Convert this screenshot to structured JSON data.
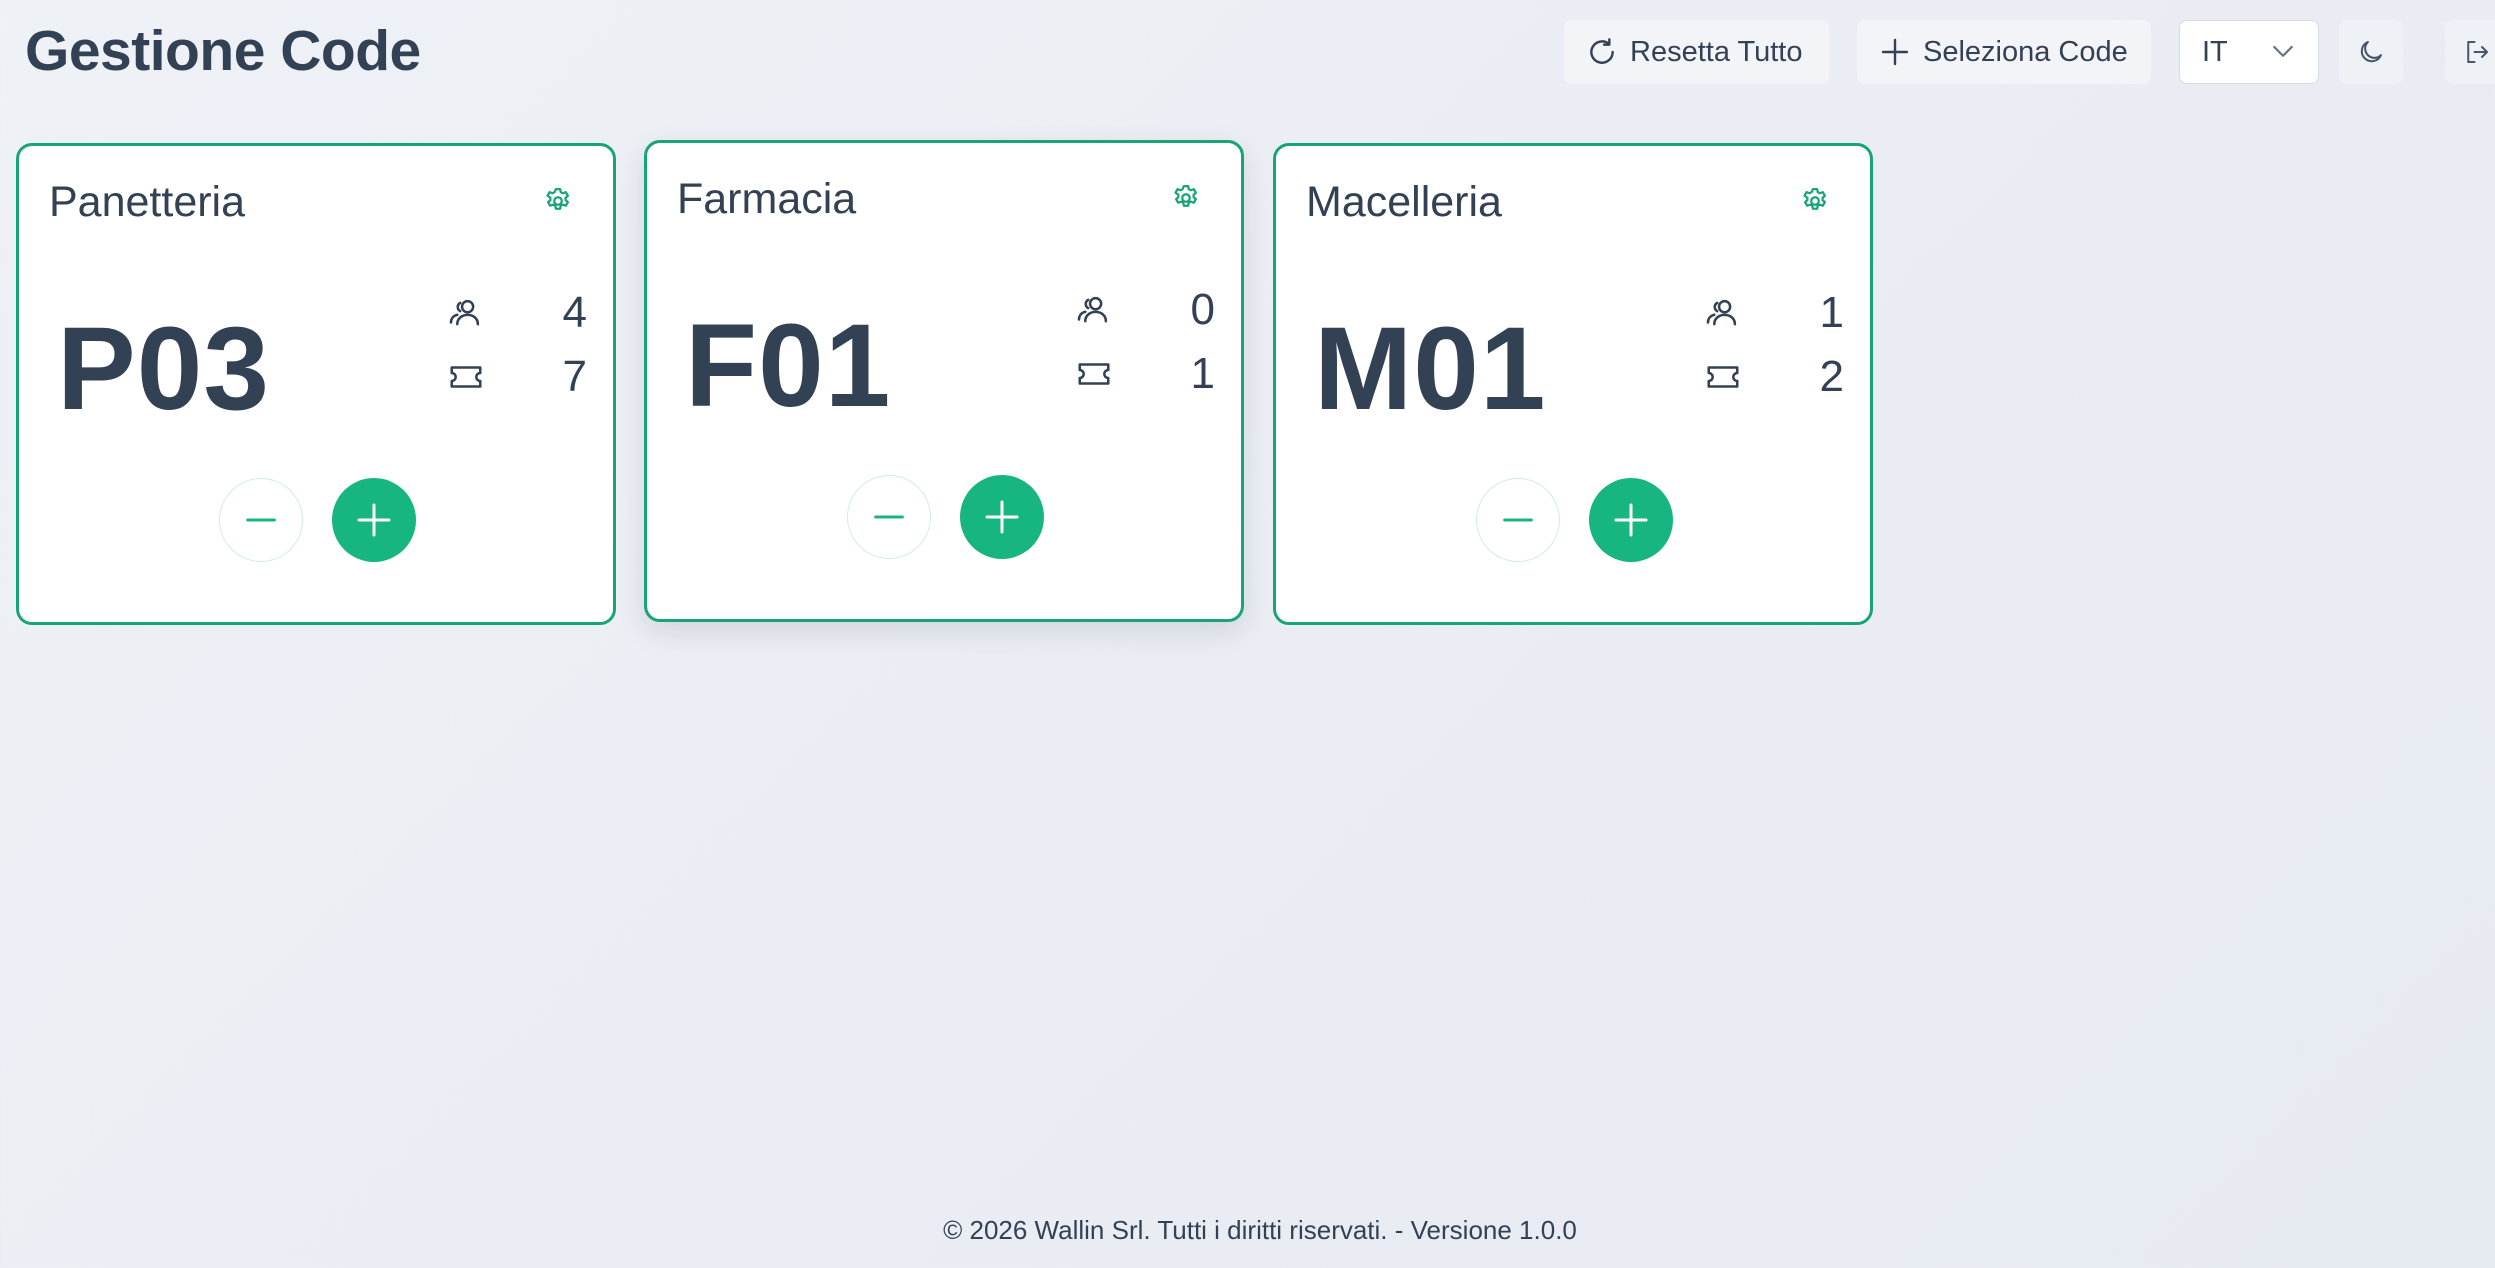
{
  "header": {
    "title": "Gestione Code",
    "reset_label": "Resetta Tutto",
    "select_label": "Seleziona Code",
    "language": "IT"
  },
  "icons": {
    "reset": "refresh-icon",
    "select": "plus-icon",
    "language": "chevron-down-icon",
    "theme": "moon-icon",
    "logout": "logout-icon",
    "settings": "gear-icon",
    "people": "users-icon",
    "tickets": "ticket-icon",
    "decrement": "minus-icon",
    "increment": "plus-icon"
  },
  "colors": {
    "accent": "#17b57f",
    "card_border": "#17a577",
    "text": "#334155",
    "background": "#eef1f6"
  },
  "queues": [
    {
      "name": "Panetteria",
      "current": "P03",
      "people_waiting": "4",
      "tickets_issued": "7"
    },
    {
      "name": "Farmacia",
      "current": "F01",
      "people_waiting": "0",
      "tickets_issued": "1"
    },
    {
      "name": "Macelleria",
      "current": "M01",
      "people_waiting": "1",
      "tickets_issued": "2"
    }
  ],
  "footer": {
    "text": "© 2026 Wallin Srl. Tutti i diritti riservati. - Versione 1.0.0"
  }
}
